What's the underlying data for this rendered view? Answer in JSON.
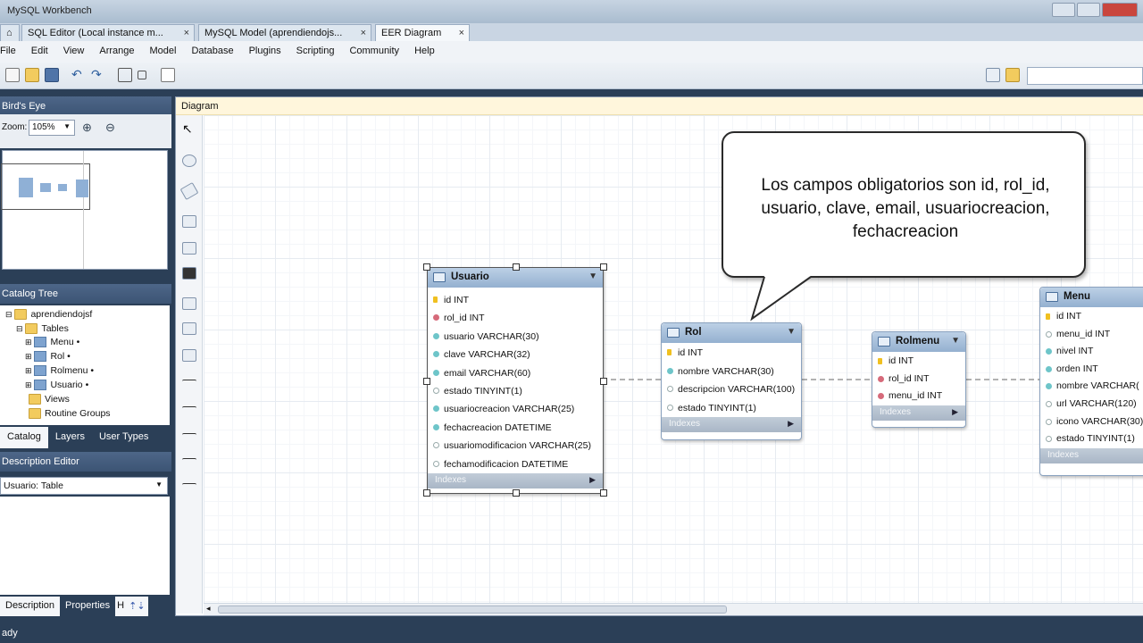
{
  "app": {
    "title": "MySQL Workbench"
  },
  "tabs": [
    {
      "label": "SQL Editor (Local instance m..."
    },
    {
      "label": "MySQL Model (aprendiendojs..."
    },
    {
      "label": "EER Diagram"
    }
  ],
  "menu": [
    "File",
    "Edit",
    "View",
    "Arrange",
    "Model",
    "Database",
    "Plugins",
    "Scripting",
    "Community",
    "Help"
  ],
  "left": {
    "birdseye_title": "Bird's Eye",
    "zoom_label": "Zoom:",
    "zoom_value": "105%",
    "catalog_title": "Catalog Tree",
    "schema": "aprendiendojsf",
    "tables_label": "Tables",
    "tables": [
      "Menu",
      "Rol",
      "Rolmenu",
      "Usuario"
    ],
    "views_label": "Views",
    "routines_label": "Routine Groups",
    "bottom_tabs": [
      "Catalog",
      "Layers",
      "User Types"
    ],
    "desc_title": "Description Editor",
    "desc_select": "Usuario: Table",
    "desc_tabs": [
      "Description",
      "Properties",
      "H"
    ]
  },
  "diagram": {
    "title": "Diagram",
    "callout": "Los campos obligatorios son id, rol_id, usuario, clave, email, usuariocreacion, fechacreacion",
    "indexes_label": "Indexes",
    "entities": {
      "usuario": {
        "name": "Usuario",
        "cols": [
          "id INT",
          "rol_id INT",
          "usuario VARCHAR(30)",
          "clave VARCHAR(32)",
          "email VARCHAR(60)",
          "estado TINYINT(1)",
          "usuariocreacion VARCHAR(25)",
          "fechacreacion DATETIME",
          "usuariomodificacion VARCHAR(25)",
          "fechamodificacion DATETIME"
        ]
      },
      "rol": {
        "name": "Rol",
        "cols": [
          "id INT",
          "nombre VARCHAR(30)",
          "descripcion VARCHAR(100)",
          "estado TINYINT(1)"
        ]
      },
      "rolmenu": {
        "name": "Rolmenu",
        "cols": [
          "id INT",
          "rol_id INT",
          "menu_id INT"
        ]
      },
      "menu": {
        "name": "Menu",
        "cols": [
          "id INT",
          "menu_id INT",
          "nivel INT",
          "orden INT",
          "nombre VARCHAR(",
          "url VARCHAR(120)",
          "icono VARCHAR(30)",
          "estado TINYINT(1)"
        ]
      }
    }
  },
  "status": {
    "text": "ady"
  }
}
